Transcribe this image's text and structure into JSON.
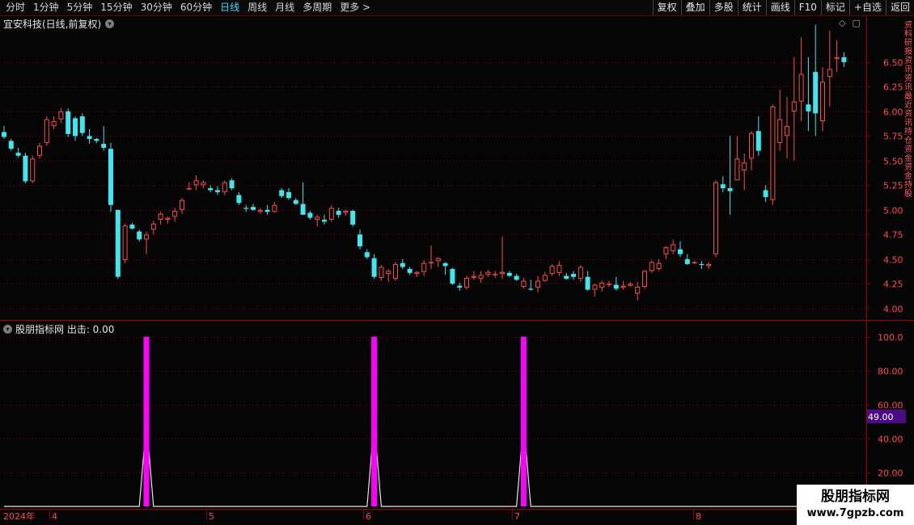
{
  "toolbar": {
    "periods": [
      "分时",
      "1分钟",
      "5分钟",
      "15分钟",
      "30分钟",
      "60分钟",
      "日线",
      "周线",
      "月线",
      "多周期",
      "更多 >"
    ],
    "active_period": "日线",
    "actions": [
      "复权",
      "叠加",
      "多股",
      "统计",
      "画线",
      "F10",
      "标记",
      "+自选",
      "返回"
    ]
  },
  "main_panel": {
    "title": "宜安科技(日线,前复权)",
    "price_axis": [
      "6.50",
      "6.25",
      "6.00",
      "5.75",
      "5.50",
      "5.25",
      "5.00",
      "4.75",
      "4.50",
      "4.25",
      "4.00"
    ],
    "right_sidebar_text": "资料研报资讯资讯最近资讯持仓资金资金持股"
  },
  "indicator_panel": {
    "title": "股朋指标网 出击: 0.00",
    "axis": [
      "100.0",
      "80.00",
      "60.00",
      "40.00",
      "20.00"
    ],
    "current_value": "49.00"
  },
  "date_axis": {
    "year_label": "2024年",
    "month_labels": [
      "4",
      "5",
      "6",
      "7",
      "8"
    ]
  },
  "watermark": {
    "title": "股朋指标网",
    "url": "www.7gpzb.com"
  },
  "colors": {
    "up": "#ff4a4a",
    "down": "#3ee6ee",
    "signal": "#ff00ff",
    "grid": "#7a0000",
    "axis_text": "#ff4a4a",
    "active": "#3fd7ff"
  },
  "chart_data": [
    {
      "type": "candlestick",
      "title": "宜安科技(日线,前复权)",
      "ylim": [
        3.9,
        6.95
      ],
      "yticks": [
        4.0,
        4.25,
        4.5,
        4.75,
        5.0,
        5.25,
        5.5,
        5.75,
        6.0,
        6.25,
        6.5
      ],
      "candles": [
        [
          5.79,
          5.85,
          5.72,
          5.74
        ],
        [
          5.7,
          5.72,
          5.6,
          5.62
        ],
        [
          5.58,
          5.63,
          5.53,
          5.55
        ],
        [
          5.55,
          5.58,
          5.27,
          5.29
        ],
        [
          5.29,
          5.55,
          5.27,
          5.52
        ],
        [
          5.55,
          5.68,
          5.52,
          5.65
        ],
        [
          5.68,
          5.95,
          5.65,
          5.92
        ],
        [
          5.85,
          5.95,
          5.82,
          5.9
        ],
        [
          5.92,
          6.03,
          5.88,
          6.0
        ],
        [
          6.0,
          6.03,
          5.74,
          5.77
        ],
        [
          5.93,
          5.95,
          5.7,
          5.75
        ],
        [
          5.95,
          5.98,
          5.75,
          5.78
        ],
        [
          5.75,
          5.82,
          5.67,
          5.72
        ],
        [
          5.72,
          5.73,
          5.68,
          5.7
        ],
        [
          5.67,
          5.85,
          5.6,
          5.63
        ],
        [
          5.62,
          5.68,
          4.98,
          5.05
        ],
        [
          5.0,
          5.0,
          4.3,
          4.32
        ],
        [
          4.49,
          4.86,
          4.46,
          4.84
        ],
        [
          4.85,
          4.87,
          4.8,
          4.81
        ],
        [
          4.78,
          4.8,
          4.68,
          4.7
        ],
        [
          4.7,
          4.78,
          4.55,
          4.75
        ],
        [
          4.8,
          4.89,
          4.75,
          4.86
        ],
        [
          4.9,
          4.98,
          4.85,
          4.96
        ],
        [
          4.9,
          4.93,
          4.86,
          4.92
        ],
        [
          4.93,
          5.02,
          4.88,
          4.99
        ],
        [
          5.0,
          5.12,
          4.96,
          5.1
        ],
        [
          5.22,
          5.28,
          5.2,
          5.22
        ],
        [
          5.25,
          5.35,
          5.2,
          5.3
        ],
        [
          5.25,
          5.3,
          5.22,
          5.28
        ],
        [
          5.22,
          5.25,
          5.18,
          5.2
        ],
        [
          5.2,
          5.24,
          5.15,
          5.18
        ],
        [
          5.18,
          5.3,
          5.15,
          5.28
        ],
        [
          5.3,
          5.32,
          5.2,
          5.22
        ],
        [
          5.15,
          5.18,
          5.05,
          5.07
        ],
        [
          5.02,
          5.05,
          4.98,
          5.01
        ],
        [
          5.03,
          5.06,
          4.99,
          5.0
        ],
        [
          4.98,
          5.02,
          4.96,
          5.0
        ],
        [
          5.0,
          5.05,
          4.95,
          4.98
        ],
        [
          4.98,
          5.08,
          4.97,
          5.05
        ],
        [
          5.2,
          5.22,
          5.12,
          5.14
        ],
        [
          5.18,
          5.22,
          5.1,
          5.12
        ],
        [
          5.1,
          5.12,
          5.05,
          5.06
        ],
        [
          5.06,
          5.28,
          5.03,
          4.95
        ],
        [
          4.97,
          4.99,
          4.9,
          4.92
        ],
        [
          4.9,
          4.95,
          4.83,
          4.93
        ],
        [
          4.9,
          4.95,
          4.85,
          4.88
        ],
        [
          4.9,
          5.05,
          4.88,
          5.02
        ],
        [
          4.99,
          5.02,
          4.92,
          4.95
        ],
        [
          4.97,
          5.0,
          4.94,
          4.99
        ],
        [
          4.99,
          5.0,
          4.83,
          4.85
        ],
        [
          4.75,
          4.8,
          4.6,
          4.63
        ],
        [
          4.57,
          4.6,
          4.5,
          4.52
        ],
        [
          4.51,
          4.55,
          4.3,
          4.32
        ],
        [
          4.31,
          4.44,
          4.28,
          4.42
        ],
        [
          4.35,
          4.4,
          4.27,
          4.38
        ],
        [
          4.3,
          4.47,
          4.28,
          4.45
        ],
        [
          4.46,
          4.5,
          4.4,
          4.42
        ],
        [
          4.4,
          4.42,
          4.34,
          4.36
        ],
        [
          4.35,
          4.38,
          4.32,
          4.37
        ],
        [
          4.37,
          4.49,
          4.33,
          4.46
        ],
        [
          4.47,
          4.64,
          4.4,
          4.47
        ],
        [
          4.48,
          4.52,
          4.42,
          4.51
        ],
        [
          4.46,
          4.47,
          4.34,
          4.43
        ],
        [
          4.4,
          4.41,
          4.24,
          4.25
        ],
        [
          4.23,
          4.26,
          4.18,
          4.21
        ],
        [
          4.21,
          4.33,
          4.19,
          4.31
        ],
        [
          4.31,
          4.38,
          4.29,
          4.33
        ],
        [
          4.3,
          4.38,
          4.26,
          4.34
        ],
        [
          4.34,
          4.39,
          4.32,
          4.37
        ],
        [
          4.34,
          4.38,
          4.31,
          4.35
        ],
        [
          4.35,
          4.73,
          4.3,
          4.37
        ],
        [
          4.36,
          4.38,
          4.32,
          4.33
        ],
        [
          4.33,
          4.35,
          4.28,
          4.29
        ],
        [
          4.22,
          4.31,
          4.2,
          4.28
        ],
        [
          4.2,
          4.29,
          4.18,
          4.19
        ],
        [
          4.21,
          4.33,
          4.16,
          4.28
        ],
        [
          4.28,
          4.37,
          4.27,
          4.34
        ],
        [
          4.35,
          4.45,
          4.33,
          4.43
        ],
        [
          4.36,
          4.48,
          4.33,
          4.44
        ],
        [
          4.33,
          4.36,
          4.29,
          4.3
        ],
        [
          4.35,
          4.38,
          4.29,
          4.32
        ],
        [
          4.3,
          4.44,
          4.27,
          4.42
        ],
        [
          4.32,
          4.38,
          4.18,
          4.19
        ],
        [
          4.19,
          4.25,
          4.12,
          4.24
        ],
        [
          4.21,
          4.28,
          4.17,
          4.26
        ],
        [
          4.25,
          4.28,
          4.22,
          4.25
        ],
        [
          4.24,
          4.32,
          4.18,
          4.2
        ],
        [
          4.21,
          4.28,
          4.19,
          4.23
        ],
        [
          4.23,
          4.27,
          4.22,
          4.25
        ],
        [
          4.15,
          4.27,
          4.08,
          4.22
        ],
        [
          4.22,
          4.39,
          4.2,
          4.38
        ],
        [
          4.38,
          4.49,
          4.36,
          4.47
        ],
        [
          4.4,
          4.5,
          4.38,
          4.46
        ],
        [
          4.55,
          4.63,
          4.5,
          4.62
        ],
        [
          4.58,
          4.7,
          4.55,
          4.65
        ],
        [
          4.6,
          4.68,
          4.52,
          4.55
        ],
        [
          4.5,
          4.55,
          4.44,
          4.45
        ],
        [
          4.46,
          4.48,
          4.45,
          4.47
        ],
        [
          4.45,
          4.48,
          4.4,
          4.44
        ],
        [
          4.43,
          4.47,
          4.4,
          4.45
        ],
        [
          4.55,
          5.3,
          4.52,
          5.28
        ],
        [
          5.26,
          5.34,
          5.18,
          5.22
        ],
        [
          5.22,
          5.75,
          4.95,
          5.19
        ],
        [
          5.3,
          5.75,
          5.3,
          5.52
        ],
        [
          5.4,
          5.57,
          5.2,
          5.48
        ],
        [
          5.52,
          5.8,
          5.4,
          5.78
        ],
        [
          5.8,
          5.95,
          5.55,
          5.6
        ],
        [
          5.2,
          5.25,
          5.08,
          5.13
        ],
        [
          5.1,
          6.07,
          5.05,
          6.05
        ],
        [
          5.68,
          6.22,
          5.6,
          5.92
        ],
        [
          5.75,
          6.15,
          5.52,
          5.85
        ],
        [
          6.0,
          6.55,
          5.5,
          6.1
        ],
        [
          6.1,
          6.75,
          5.9,
          6.38
        ],
        [
          6.07,
          6.55,
          5.8,
          6.0
        ],
        [
          6.4,
          6.88,
          5.75,
          5.98
        ],
        [
          5.9,
          6.45,
          5.8,
          6.3
        ],
        [
          6.35,
          6.82,
          6.05,
          6.43
        ],
        [
          6.53,
          6.72,
          6.4,
          6.55
        ],
        [
          6.55,
          6.6,
          6.45,
          6.5
        ]
      ]
    },
    {
      "type": "line",
      "title": "股朋指标网 出击: 0.00",
      "ylim": [
        0,
        100
      ],
      "yticks": [
        20,
        40,
        60,
        80,
        100
      ],
      "x": [
        1,
        2,
        3,
        4,
        5,
        6,
        7,
        8,
        9,
        10,
        11,
        12,
        13,
        14,
        15,
        16,
        17,
        18,
        19,
        20,
        21,
        22,
        23,
        24,
        25,
        26,
        27,
        28,
        29,
        30,
        31,
        32,
        33,
        34,
        35,
        36,
        37,
        38,
        39,
        40,
        41,
        42,
        43,
        44,
        45,
        46,
        47,
        48,
        49,
        50,
        51,
        52,
        53,
        54,
        55,
        56,
        57,
        58,
        59,
        60,
        61,
        62,
        63,
        64,
        65,
        66,
        67,
        68,
        69,
        70,
        71,
        72,
        73,
        74,
        75,
        76,
        77,
        78,
        79,
        80,
        81,
        82,
        83,
        84,
        85,
        86,
        87,
        88,
        89,
        90,
        91,
        92,
        93,
        94,
        95,
        96,
        97,
        98,
        99,
        100,
        101,
        102,
        103,
        104,
        105,
        106,
        107,
        108,
        109,
        110,
        111,
        112,
        113,
        114,
        115,
        116,
        117,
        118,
        119,
        120
      ],
      "values": [
        0,
        0,
        0,
        0,
        0,
        0,
        0,
        0,
        0,
        0,
        0,
        0,
        0,
        0,
        0,
        0,
        0,
        0,
        0,
        0,
        100,
        0,
        0,
        0,
        0,
        0,
        0,
        0,
        0,
        0,
        0,
        0,
        0,
        0,
        0,
        0,
        0,
        0,
        0,
        0,
        0,
        0,
        0,
        0,
        0,
        0,
        0,
        0,
        0,
        0,
        0,
        0,
        100,
        0,
        0,
        0,
        0,
        0,
        0,
        0,
        0,
        0,
        0,
        0,
        0,
        0,
        0,
        0,
        0,
        0,
        0,
        0,
        0,
        100,
        0,
        0,
        0,
        0,
        0,
        0,
        0,
        0,
        0,
        0,
        0,
        0,
        0,
        0,
        0,
        0,
        0,
        0,
        0,
        0,
        0,
        0,
        0,
        0,
        0,
        0,
        0,
        0,
        0,
        0,
        0,
        0,
        0,
        0,
        0,
        0,
        0,
        0,
        0,
        0,
        0,
        0,
        0,
        0,
        0,
        0
      ],
      "signals": [
        21,
        53,
        74
      ]
    }
  ]
}
